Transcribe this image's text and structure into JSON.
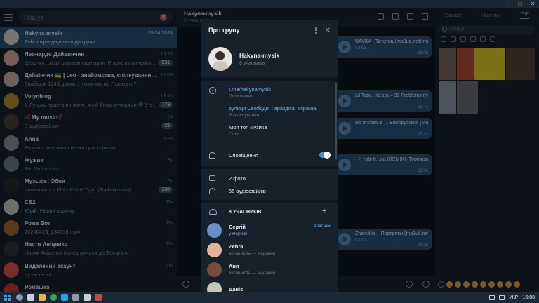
{
  "window": {
    "controls": [
      "–",
      "□",
      "✕"
    ]
  },
  "sidebar": {
    "search_placeholder": "Пошук",
    "chats": [
      {
        "name": "Hakyna-mysik",
        "time": "25.04.2024",
        "message": "Zehra приєднується до групи",
        "sender": "",
        "badge": "",
        "active": true,
        "avatar_color": "#d7d2cc"
      },
      {
        "name": "Леонардо Дайвинчик",
        "time": "15:33",
        "message": "Девочки, разыгрываем еще один iPhone из линейки...",
        "sender": "",
        "badge": "531",
        "active": false,
        "avatar_color": "#d9a9a0"
      },
      {
        "name": "Дайвінчик 🇺🇦 | Leo - знайомства, спілкування та нові д...",
        "time": "14:05",
        "message": "Знайшов 1243 дівчат з твого міста. Показати?",
        "sender": "",
        "badge": "",
        "active": false,
        "avatar_color": "#c9b2a8"
      },
      {
        "name": "Volynblog",
        "time": "13:45",
        "message": "У Луцьку прихтвіли поля, який бігав вулицями 😳 У вечіл...",
        "sender": "",
        "badge": "779",
        "active": false,
        "avatar_color": "#b2893a"
      },
      {
        "name": "🥀My music🥀",
        "time": "29",
        "message": "3 аудіофайли",
        "sender": "",
        "badge": "28",
        "active": false,
        "avatar_color": "#4a4038"
      },
      {
        "name": "Anna",
        "time": "0:20",
        "message": "Розуміє, теж гошів не на ту професію",
        "sender": "",
        "badge": "",
        "active": false,
        "avatar_color": "#8b8f95"
      },
      {
        "name": "Жужикі",
        "time": "Вт",
        "message": "Ви: Хорошошо",
        "sender": "",
        "badge": "",
        "active": false,
        "avatar_color": "#6b7d8e"
      },
      {
        "name": "Музыка | Обои",
        "time": "Вт",
        "message": "<unknown> - KIN - Cat & Tiger (Tophaip.com)",
        "sender": "",
        "badge": "280",
        "active": false,
        "avatar_color": "#2a2a2a"
      },
      {
        "name": "CS2",
        "time": "Пн",
        "message": "Нерви ящичку",
        "sender": "Юрій: ",
        "badge": "",
        "active": false,
        "avatar_color": "#c9c7c2"
      },
      {
        "name": "Рома Бот",
        "time": "Пн",
        "message": "20240423_134658.mp4",
        "sender": "",
        "badge": "",
        "active": false,
        "avatar_color": "#a46a3a"
      },
      {
        "name": "Настя Аніценко",
        "time": "Пн",
        "message": "Настя Аніценко приєднується до Telegram",
        "sender": "",
        "badge": "",
        "active": false,
        "avatar_color": "#303438"
      },
      {
        "name": "Видалений акаунт",
        "time": "Пн",
        "message": "ну не нє нe",
        "sender": "",
        "badge": "",
        "active": false,
        "avatar_color": "#d9534f"
      },
      {
        "name": "Ромашка",
        "time": "",
        "message": "",
        "sender": "",
        "badge": "",
        "active": false,
        "avatar_color": "#c23b3b"
      }
    ]
  },
  "chat": {
    "title": "Hakyna-mysik",
    "subtitle": "8 учасників",
    "messages": [
      {
        "title": "NAVKA - Тататиц (mp3ua.net).mp3",
        "duration": "03:03",
        "time": "18:08"
      },
      {
        "title": "Lil Tape, Kizaru – 99 Problems (mp3uk.net)",
        "duration": "",
        "time": "15:43"
      },
      {
        "title": "Но играем в ... Белорусских (Muzes.net)",
        "duration": "",
        "time": "15:43"
      },
      {
        "title": "- Я тобі б...ла (REMIX) (Topmusicua_com)",
        "duration": "",
        "time": "19:06"
      },
      {
        "title": "Zhanulka – Портреты (mp3uk.net)",
        "duration": "03:02",
        "time": "21:25"
      }
    ]
  },
  "gif_panel": {
    "tabs": [
      "Емодзі",
      "Наліпки",
      "GIF"
    ],
    "active_tab": "GIF",
    "search_placeholder": "Пошук",
    "gif_colors": [
      "#7b6a5d",
      "#b24a3a",
      "#e2cd2a",
      "#5a4036",
      "#8a98a5",
      "#6a6f75"
    ]
  },
  "modal": {
    "title": "Про групу",
    "group_name": "Hakyna-mysik",
    "group_members": "8 учасників",
    "info": [
      {
        "value": "t.me/hakynamysik",
        "label": "Посилання",
        "link": true
      },
      {
        "value": "вулиця Свободи, Гаразджа, Україна",
        "label": "Розташування",
        "link": true
      },
      {
        "value": "Моя топ музика",
        "label": "Опис",
        "link": false
      }
    ],
    "notifications_label": "Сповіщення",
    "notifications_on": true,
    "photos": "2 фото",
    "audio": "56 аудіофайлів",
    "members_header": "8 УЧАСНИКІВ",
    "members": [
      {
        "name": "Сергій",
        "status": "у мережі",
        "online": true,
        "role": "власник",
        "avatar_color": "#6a8fc9"
      },
      {
        "name": "Zehra",
        "status": "активність — недавно",
        "online": false,
        "role": "",
        "avatar_color": "#e0b49a"
      },
      {
        "name": "Аня",
        "status": "активність — недавно",
        "online": false,
        "role": "",
        "avatar_color": "#7a4a3e"
      },
      {
        "name": "Даніс",
        "status": "",
        "online": false,
        "role": "",
        "avatar_color": "#c9c4bd"
      }
    ]
  },
  "taskbar": {
    "lang": "УКР",
    "time": "16:08"
  }
}
